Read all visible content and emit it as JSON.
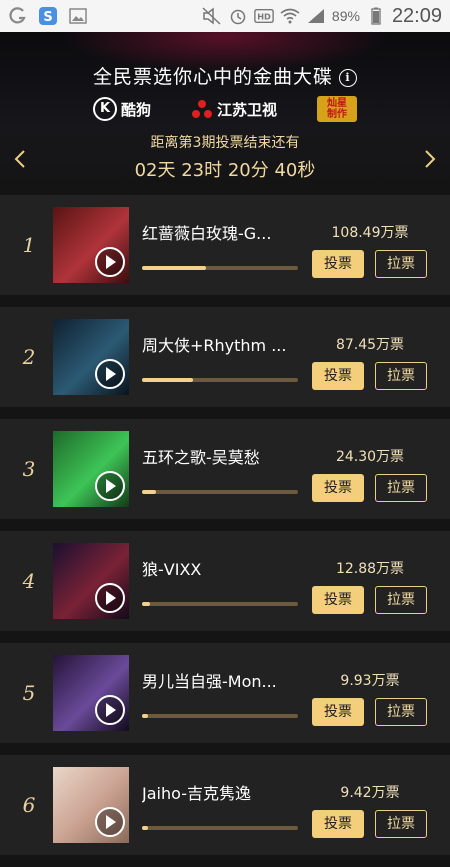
{
  "status_bar": {
    "battery": "89%",
    "time": "22:09"
  },
  "header": {
    "slogan": "全民票选你心中的金曲大碟",
    "brands": [
      "酷狗",
      "江苏卫视",
      "灿星制作"
    ],
    "countdown_label": "距离第3期投票结束还有",
    "countdown_value": "02天 23时 20分 40秒"
  },
  "list": {
    "vote_label": "投票",
    "pull_label": "拉票",
    "items": [
      {
        "rank": "1",
        "title": "红蔷薇白玫瑰-G...",
        "votes": "108.49万票",
        "progress": 0.41,
        "thumb": [
          "#5a1414",
          "#b0343a",
          "#3a0e0e"
        ]
      },
      {
        "rank": "2",
        "title": "周大侠+Rhythm ...",
        "votes": "87.45万票",
        "progress": 0.33,
        "thumb": [
          "#102030",
          "#2c5a74",
          "#0a141c"
        ]
      },
      {
        "rank": "3",
        "title": "五环之歌-吴莫愁",
        "votes": "24.30万票",
        "progress": 0.09,
        "thumb": [
          "#1e6a2a",
          "#3ec456",
          "#123a18"
        ]
      },
      {
        "rank": "4",
        "title": "狼-VIXX",
        "votes": "12.88万票",
        "progress": 0.05,
        "thumb": [
          "#1a1030",
          "#7a2236",
          "#140a1a"
        ]
      },
      {
        "rank": "5",
        "title": "男儿当自强-Mon...",
        "votes": "9.93万票",
        "progress": 0.04,
        "thumb": [
          "#241438",
          "#6a4a9a",
          "#120a1c"
        ]
      },
      {
        "rank": "6",
        "title": "Jaiho-吉克隽逸",
        "votes": "9.42万票",
        "progress": 0.04,
        "thumb": [
          "#ead6c8",
          "#c9a090",
          "#8a6a5a"
        ]
      }
    ]
  }
}
